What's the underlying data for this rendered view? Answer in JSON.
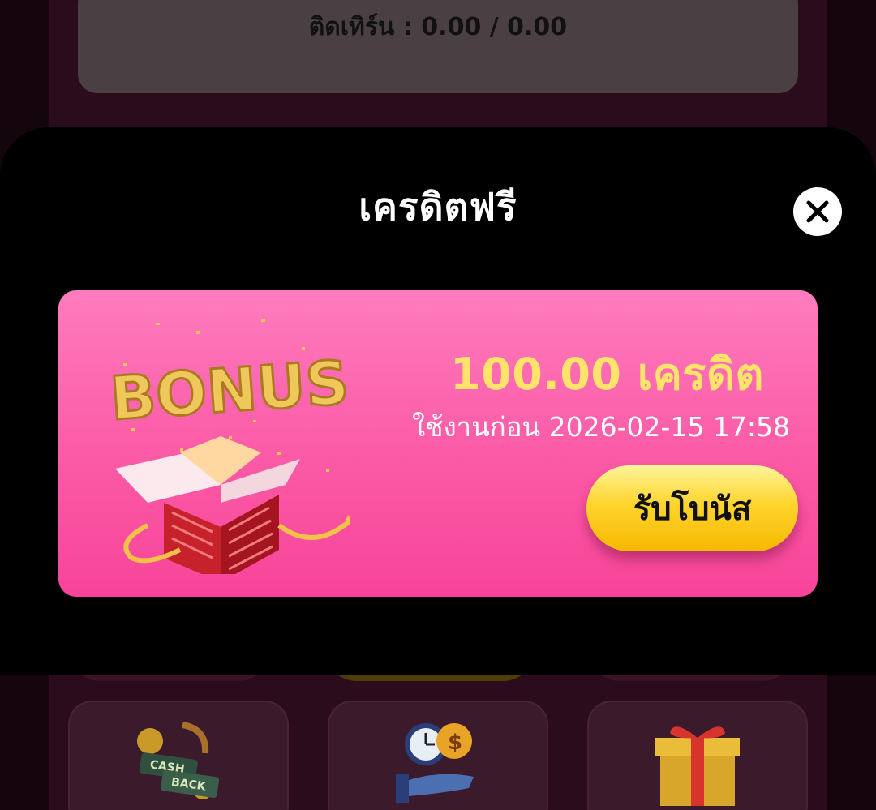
{
  "background": {
    "turnover_text": "ติดเทิร์น : 0.00 / 0.00",
    "menu_tiles": [
      {
        "icon": "cashback-icon",
        "label": "CASH BACK"
      },
      {
        "icon": "clock-money-icon"
      },
      {
        "icon": "gift-box-icon"
      }
    ]
  },
  "modal": {
    "title": "เครดิตฟรี",
    "close_icon": "close-icon"
  },
  "bonus_card": {
    "art_text": "BONUS",
    "amount": "100.00 เครดิต",
    "expiry": "ใช้งานก่อน 2026-02-15 17:58",
    "claim_label": "รับโบนัส"
  },
  "colors": {
    "modal_bg": "#000000",
    "card_pink": "#fb5aa6",
    "amount_yellow": "#ffe36a",
    "button_yellow": "#ffd52e"
  }
}
